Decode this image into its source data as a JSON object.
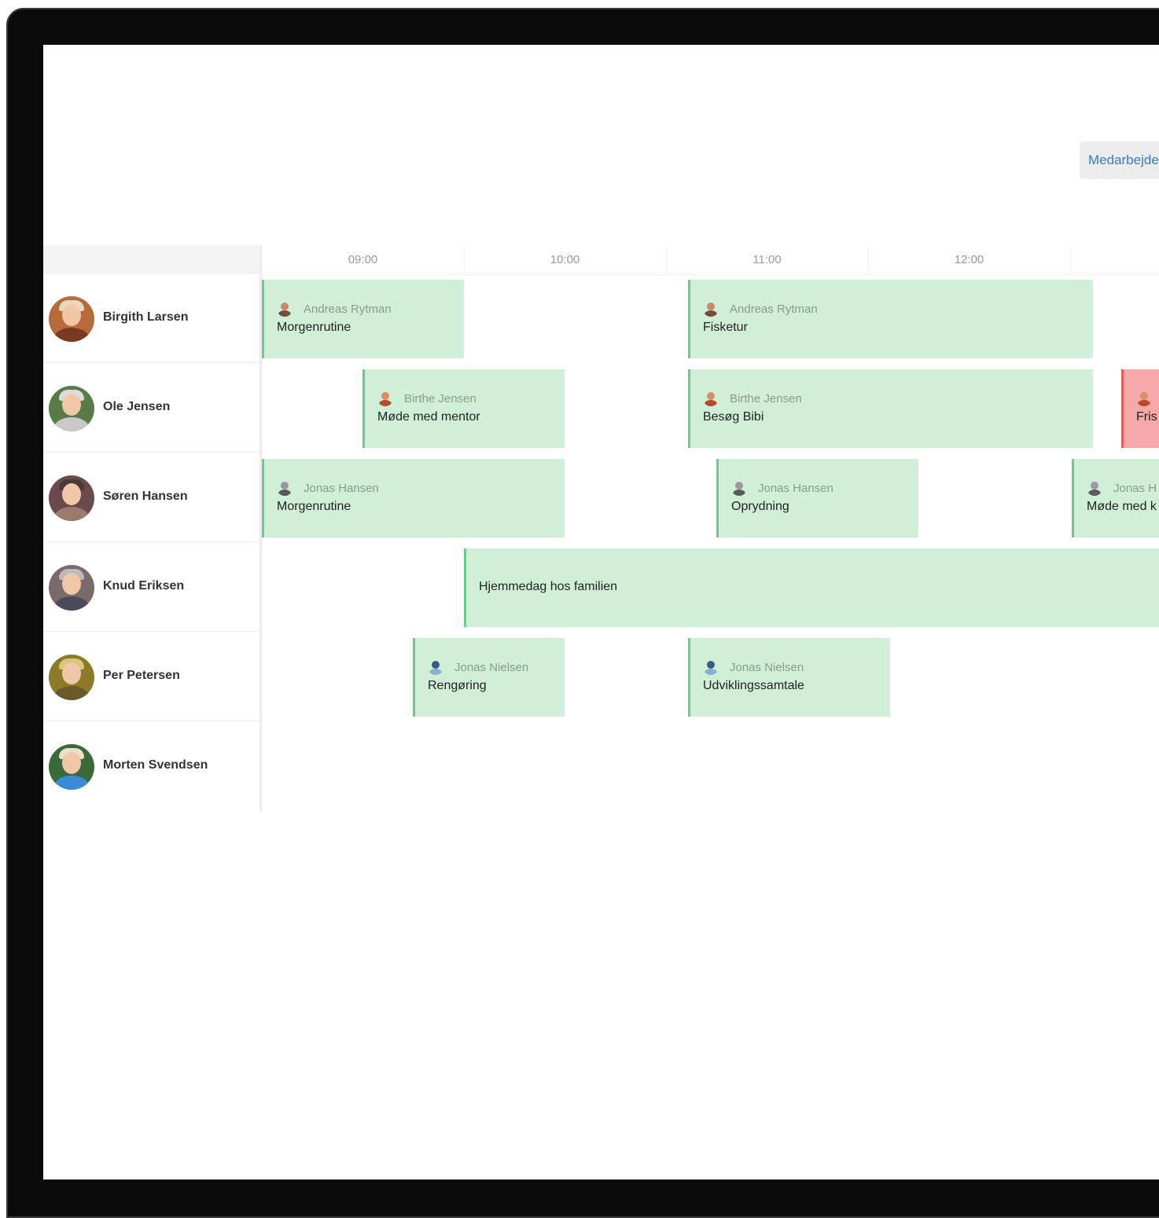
{
  "toolbar": {
    "view_button": "Medarbejde"
  },
  "timeline": {
    "hours": [
      "09:00",
      "10:00",
      "11:00",
      "12:00",
      ""
    ]
  },
  "people": [
    {
      "name": "Birgith Larsen"
    },
    {
      "name": "Ole Jensen"
    },
    {
      "name": "Søren Hansen"
    },
    {
      "name": "Knud Eriksen"
    },
    {
      "name": "Per Petersen"
    },
    {
      "name": "Morten Svendsen"
    }
  ],
  "events": [
    {
      "employee": "Andreas Rytman",
      "task": "Morgenrutine",
      "status": "ok"
    },
    {
      "employee": "Andreas Rytman",
      "task": "Fisketur",
      "status": "ok"
    },
    {
      "employee": "Birthe Jensen",
      "task": "Møde med mentor",
      "status": "ok"
    },
    {
      "employee": "Birthe Jensen",
      "task": "Besøg Bibi",
      "status": "ok"
    },
    {
      "employee": "",
      "task": "Fris",
      "status": "alert"
    },
    {
      "employee": "Jonas Hansen",
      "task": "Morgenrutine",
      "status": "ok"
    },
    {
      "employee": "Jonas Hansen",
      "task": "Oprydning",
      "status": "ok"
    },
    {
      "employee": "Jonas H",
      "task": "Møde med k",
      "status": "ok"
    },
    {
      "employee": "",
      "task": "Hjemmedag hos familien",
      "status": "ok"
    },
    {
      "employee": "Jonas Nielsen",
      "task": "Rengøring",
      "status": "ok"
    },
    {
      "employee": "Jonas Nielsen",
      "task": "Udviklingssamtale",
      "status": "ok"
    }
  ],
  "colors": {
    "event_bg": "#d0efd7",
    "event_border": "#70c98a",
    "alert_bg": "#f7a8a8",
    "alert_border": "#e85c5c",
    "link_blue": "#3a7cc4"
  }
}
